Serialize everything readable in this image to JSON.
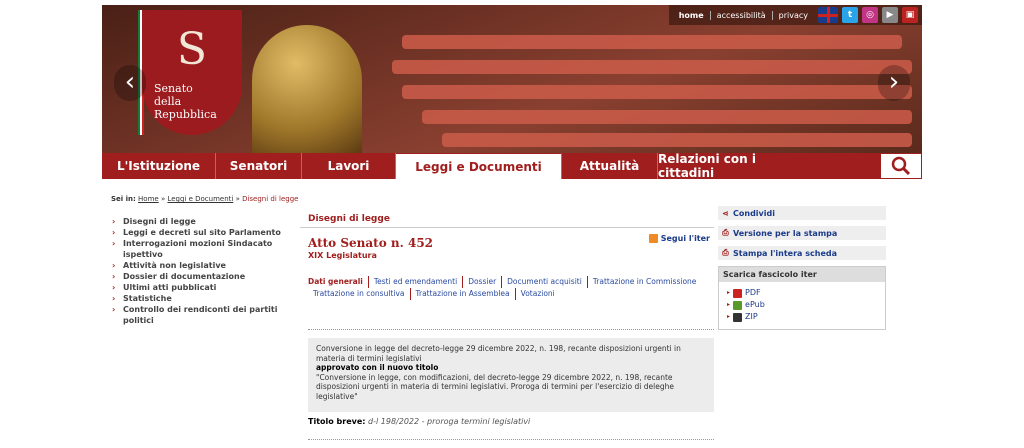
{
  "toplinks": {
    "home": "home",
    "accessibilita": "accessibilità",
    "privacy": "privacy"
  },
  "logo": {
    "emblem": "S",
    "name_line1": "Senato",
    "name_line2": "della Repubblica"
  },
  "nav": {
    "items": [
      "L'Istituzione",
      "Senatori",
      "Lavori",
      "Leggi e Documenti",
      "Attualità",
      "Relazioni con i cittadini"
    ],
    "active": "Leggi e Documenti"
  },
  "breadcrumb": {
    "label": "Sei in:",
    "home": "Home",
    "level1": "Leggi e Documenti",
    "current": "Disegni di legge"
  },
  "leftnav": {
    "items": [
      "Disegni di legge",
      "Leggi e decreti sul sito Parlamento",
      "Interrogazioni mozioni Sindacato ispettivo",
      "Attività non legislative",
      "Dossier di documentazione",
      "Ultimi atti pubblicati",
      "Statistiche",
      "Controllo dei rendiconti dei partiti politici"
    ]
  },
  "main": {
    "section": "Disegni di legge",
    "title": "Atto Senato n. 452",
    "legislatura": "XIX Legislatura",
    "segui": "Segui l'iter",
    "tabs": [
      "Dati generali",
      "Testi ed emendamenti",
      "Dossier",
      "Documenti acquisiti",
      "Trattazione in Commissione",
      "Trattazione in consultiva",
      "Trattazione in Assemblea",
      "Votazioni"
    ],
    "desc1": "Conversione in legge del decreto-legge 29 dicembre 2022, n. 198, recante disposizioni urgenti in materia di termini legislativi",
    "approved": "approvato con il nuovo titolo",
    "desc2": "\"Conversione in legge, con modificazioni, del decreto-legge 29 dicembre 2022, n. 198, recante disposizioni urgenti in materia di termini legislativi. Proroga di termini per l'esercizio di deleghe legislative\"",
    "breve_label": "Titolo breve:",
    "breve_value": "d-l 198/2022 - proroga termini legislativi"
  },
  "right": {
    "condividi": "Condividi",
    "stampa": "Versione per la stampa",
    "stampa_intera": "Stampa l'intera scheda",
    "fascicolo": "Scarica fascicolo iter",
    "formats": [
      "PDF",
      "ePub",
      "ZIP"
    ]
  },
  "colors": {
    "brand": "#a01e1e",
    "link": "#1a3a8a"
  }
}
